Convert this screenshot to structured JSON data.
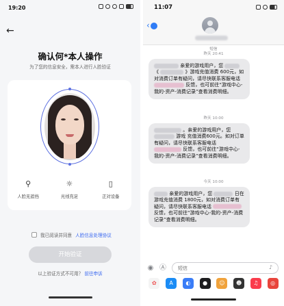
{
  "left": {
    "status_time": "19:20",
    "title": "确认何*本人操作",
    "subtitle": "为了您的信息安全，需本人进行人脸验证",
    "tips": [
      {
        "label": "人脸无遮挡",
        "icon": "person-icon"
      },
      {
        "label": "光线充足",
        "icon": "sun-icon"
      },
      {
        "label": "正对设备",
        "icon": "phone-icon"
      }
    ],
    "agree_text": "我已阅读并同意",
    "agree_link": "人脸信息处理协议",
    "start_button": "开始验证",
    "alt_text": "以上验证方式不可用？",
    "alt_link": "前往申诉",
    "colors": {
      "accent": "#3b69f0",
      "face_ring": "#5b6fe0",
      "button_disabled": "#d7d8dc"
    }
  },
  "right": {
    "status_time": "11:07",
    "input_placeholder": "短信",
    "messages": [
      {
        "date_line1": "短信",
        "date_line2": "昨天 20:41",
        "parts": [
          "亲爱的游戏用户，您",
          "《",
          "》游戏充值消费",
          "600元，如对消费订单有疑问，请尽快联系客服电话",
          "反馈，也可前往“游戏中心-我的-资产-消费记录”查看消费明细。"
        ]
      },
      {
        "date_line1": "昨天 10:00",
        "parts": [
          "。亲爱的游戏用户，您",
          "游戏",
          "充值消费600元。如对订单有疑问，请尽快联系客服电话",
          "反馈，也可前往“游戏中心-我的-资产-消费记录”查看消费明细。"
        ]
      },
      {
        "date_line1": "今天 10:00",
        "parts": [
          "亲爱的游戏用户，您",
          "日在游戏充值消费",
          "1800元，如对消费订单有疑问，请尽快联系客服电话",
          "反馈，也可前往“游戏中心-我的-资产-消费记录”查看消费明细。"
        ]
      }
    ],
    "colors": {
      "link": "#2f7cf6",
      "bubble": "#e9e9eb"
    }
  }
}
